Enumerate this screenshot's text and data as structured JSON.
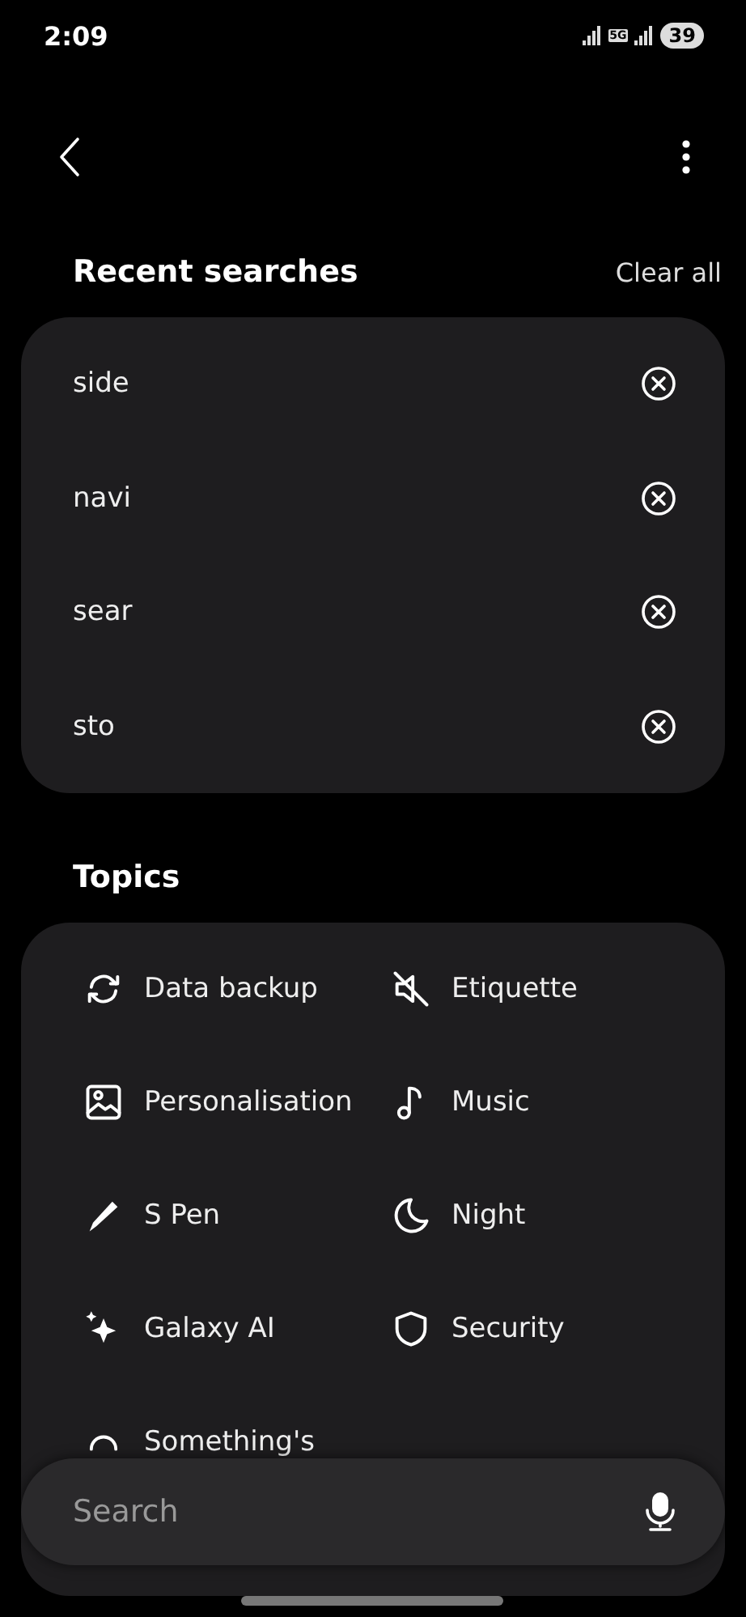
{
  "status_bar": {
    "time": "2:09",
    "network": "5G",
    "battery": "39"
  },
  "recent": {
    "title": "Recent searches",
    "clear": "Clear all",
    "items": [
      {
        "text": "side"
      },
      {
        "text": "navi"
      },
      {
        "text": "sear"
      },
      {
        "text": "sto"
      }
    ]
  },
  "topics": {
    "title": "Topics",
    "items": [
      {
        "label": "Data backup",
        "kind": "sync"
      },
      {
        "label": "Etiquette",
        "kind": "mute"
      },
      {
        "label": "Personalisation",
        "kind": "image"
      },
      {
        "label": "Music",
        "kind": "note"
      },
      {
        "label": "S Pen",
        "kind": "pen"
      },
      {
        "label": "Night",
        "kind": "moon"
      },
      {
        "label": "Galaxy AI",
        "kind": "sparkle"
      },
      {
        "label": "Security",
        "kind": "shield"
      },
      {
        "label": "Something's",
        "kind": "circle"
      }
    ]
  },
  "search": {
    "placeholder": "Search"
  }
}
